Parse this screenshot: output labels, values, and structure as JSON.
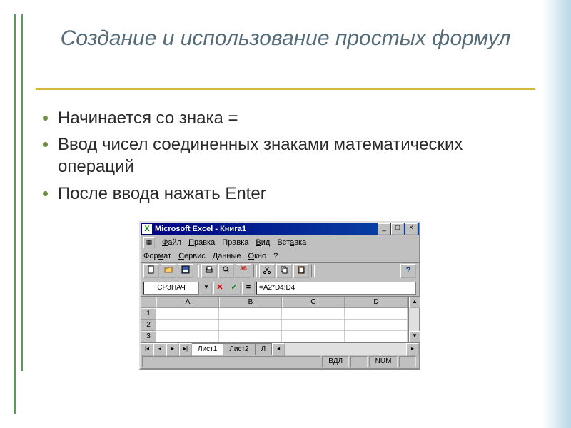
{
  "title": "Создание и использование простых формул",
  "bullets": [
    "Начинается со знака =",
    "Ввод чисел соединенных знаками математических операций",
    "После ввода нажать Enter"
  ],
  "excel": {
    "window_title": "Microsoft Excel - Книга1",
    "app_icon": "X",
    "min": "_",
    "max": "□",
    "close": "×",
    "menus_row1": [
      "Файл",
      "Правка",
      "Правка",
      "Вид",
      "Вставка"
    ],
    "menus_row2": [
      "Формат",
      "Сервис",
      "Данные",
      "Окно",
      "?"
    ],
    "name_box": "СРЗНАЧ",
    "formula": "=A2*D4:D4",
    "cancel": "✕",
    "ok": "✓",
    "eq": "=",
    "columns": [
      "A",
      "B",
      "C",
      "D"
    ],
    "rows": [
      "1",
      "2",
      "3"
    ],
    "sheet_tabs": [
      "Лист1",
      "Лист2",
      "Л"
    ],
    "status_left": "",
    "status_mid": "ВДЛ",
    "status_num": "NUM",
    "help": "?"
  }
}
